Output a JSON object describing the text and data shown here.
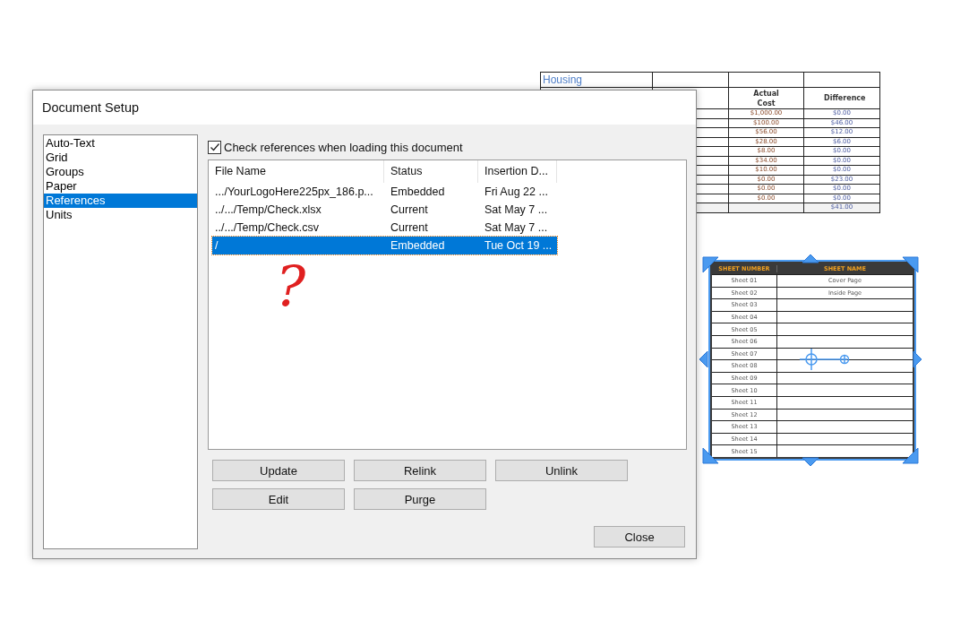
{
  "housing_table": {
    "title": "Housing",
    "columns": [
      "Actual Cost",
      "Difference"
    ],
    "rows": [
      {
        "actual": "$1,000.00",
        "difference": "$0.00"
      },
      {
        "actual": "$100.00",
        "difference": "$46.00"
      },
      {
        "actual": "$56.00",
        "difference": "$12.00"
      },
      {
        "actual": "$28.00",
        "difference": "$6.00"
      },
      {
        "actual": "$8.00",
        "difference": "$0.00"
      },
      {
        "actual": "$34.00",
        "difference": "$0.00"
      },
      {
        "actual": "$10.00",
        "difference": "$0.00"
      },
      {
        "actual": "$0.00",
        "difference": "$23.00"
      },
      {
        "actual": "$0.00",
        "difference": "$0.00"
      },
      {
        "actual": "$0.00",
        "difference": "$0.00"
      }
    ],
    "total": {
      "difference": "$41.00"
    }
  },
  "sheet_table": {
    "columns": [
      "SHEET NUMBER",
      "SHEET NAME"
    ],
    "rows": [
      {
        "number": "Sheet 01",
        "name": "Cover Page"
      },
      {
        "number": "Sheet 02",
        "name": "Inside Page"
      },
      {
        "number": "Sheet 03"
      },
      {
        "number": "Sheet 04"
      },
      {
        "number": "Sheet 05"
      },
      {
        "number": "Sheet 06"
      },
      {
        "number": "Sheet 07"
      },
      {
        "number": "Sheet 08"
      },
      {
        "number": "Sheet 09"
      },
      {
        "number": "Sheet 10"
      },
      {
        "number": "Sheet 11"
      },
      {
        "number": "Sheet 12"
      },
      {
        "number": "Sheet 13"
      },
      {
        "number": "Sheet 14"
      },
      {
        "number": "Sheet 15"
      }
    ],
    "selected": true
  },
  "annotation": "?",
  "dialog": {
    "title": "Document Setup",
    "categories": [
      {
        "label": "Auto-Text",
        "selected": false
      },
      {
        "label": "Grid",
        "selected": false
      },
      {
        "label": "Groups",
        "selected": false
      },
      {
        "label": "Paper",
        "selected": false
      },
      {
        "label": "References",
        "selected": true
      },
      {
        "label": "Units",
        "selected": false
      }
    ],
    "check_references": {
      "label": "Check references when loading this document",
      "checked": true
    },
    "references": {
      "columns": [
        "File Name",
        "Status",
        "Insertion D..."
      ],
      "rows": [
        {
          "file_name": ".../YourLogoHere225px_186.p...",
          "status": "Embedded",
          "insertion_date": "Fri Aug 22 ...",
          "selected": false
        },
        {
          "file_name": "../.../Temp/Check.xlsx",
          "status": "Current",
          "insertion_date": "Sat May  7 ...",
          "selected": false
        },
        {
          "file_name": "../.../Temp/Check.csv",
          "status": "Current",
          "insertion_date": "Sat May  7 ...",
          "selected": false
        },
        {
          "file_name": "/",
          "status": "Embedded",
          "insertion_date": "Tue Oct 19 ...",
          "selected": true
        }
      ]
    },
    "buttons": [
      "Update",
      "Relink",
      "Unlink",
      "Edit",
      "Purge"
    ],
    "close_button": "Close"
  }
}
